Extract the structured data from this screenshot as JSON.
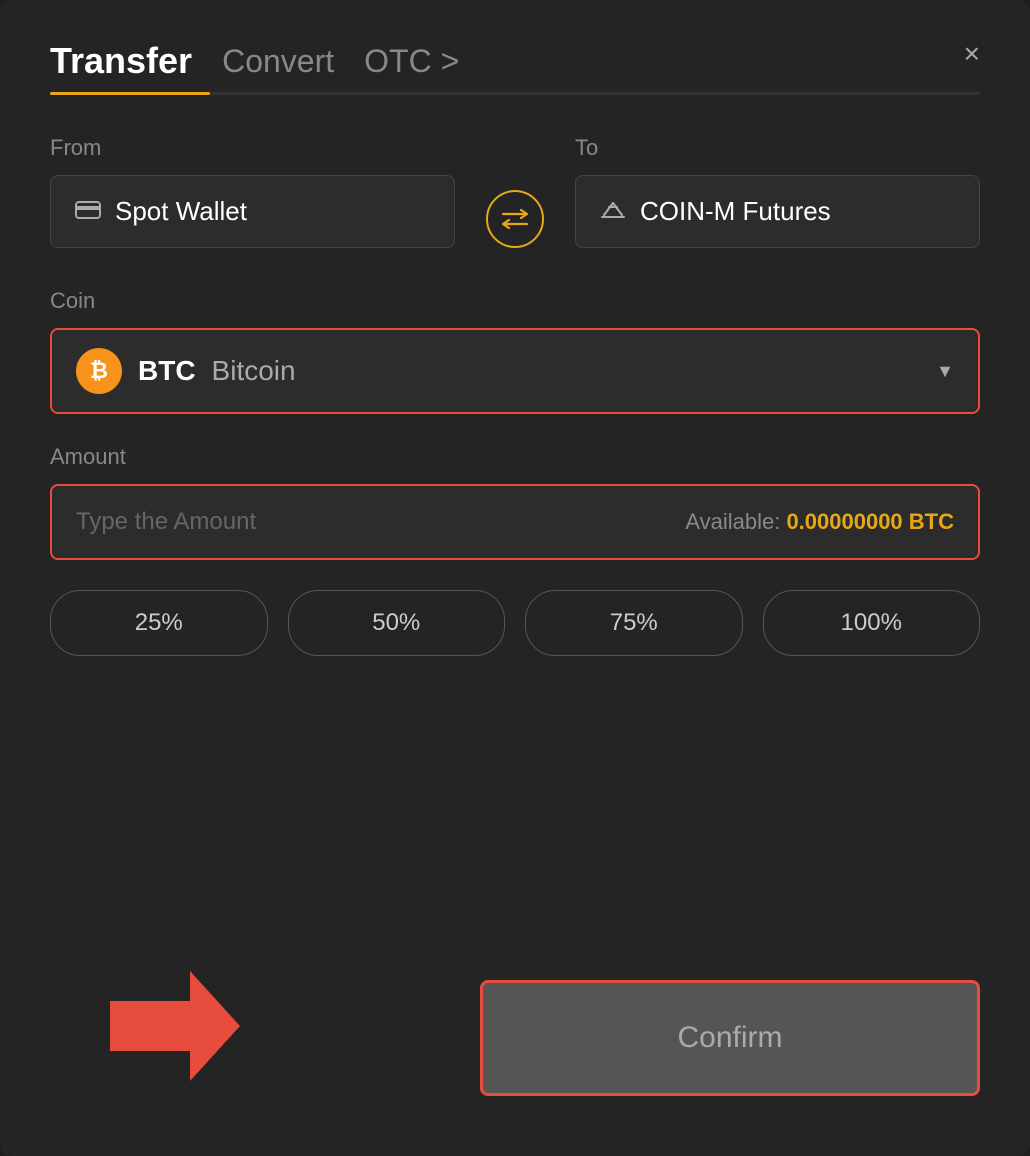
{
  "header": {
    "tab_transfer": "Transfer",
    "tab_convert": "Convert",
    "tab_otc": "OTC >",
    "close_label": "×"
  },
  "from": {
    "label": "From",
    "wallet_name": "Spot Wallet"
  },
  "to": {
    "label": "To",
    "wallet_name": "COIN-M Futures"
  },
  "coin": {
    "label": "Coin",
    "symbol": "BTC",
    "full_name": "Bitcoin"
  },
  "amount": {
    "label": "Amount",
    "placeholder": "Type the Amount",
    "available_label": "Available:",
    "available_value": "0.00000000 BTC"
  },
  "percent_buttons": [
    "25%",
    "50%",
    "75%",
    "100%"
  ],
  "confirm_button": "Confirm"
}
